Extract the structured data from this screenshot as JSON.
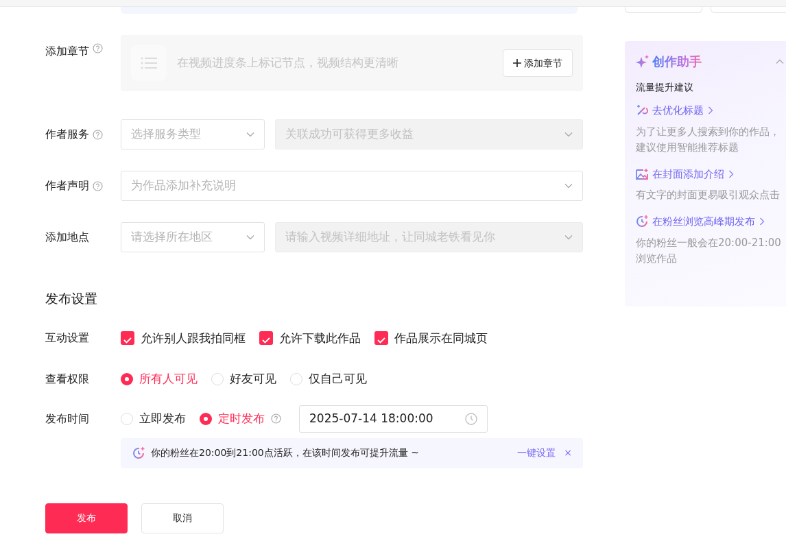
{
  "chapter": {
    "label": "添加章节",
    "hint": "在视频进度条上标记节点，视频结构更清晰",
    "button": "添加章节"
  },
  "select_rows": [
    {
      "label": "作者服务",
      "help": true,
      "selects": [
        {
          "placeholder": "选择服务类型",
          "disabled": false,
          "wide": false
        },
        {
          "placeholder": "关联成功可获得更多收益",
          "disabled": true,
          "wide": true
        }
      ]
    },
    {
      "label": "作者声明",
      "help": true,
      "selects": [
        {
          "placeholder": "为作品添加补充说明",
          "disabled": false,
          "wide": true
        }
      ]
    },
    {
      "label": "添加地点",
      "help": false,
      "selects": [
        {
          "placeholder": "请选择所在地区",
          "disabled": false,
          "wide": false
        },
        {
          "placeholder": "请输入视频详细地址，让同城老铁看见你",
          "disabled": true,
          "wide": true
        }
      ]
    }
  ],
  "publish_settings": {
    "heading": "发布设置",
    "interaction": {
      "label": "互动设置",
      "options": [
        {
          "label": "允许别人跟我拍同框",
          "checked": true
        },
        {
          "label": "允许下载此作品",
          "checked": true
        },
        {
          "label": "作品展示在同城页",
          "checked": true
        }
      ]
    },
    "visibility": {
      "label": "查看权限",
      "options": [
        {
          "label": "所有人可见",
          "selected": true
        },
        {
          "label": "好友可见",
          "selected": false
        },
        {
          "label": "仅自己可见",
          "selected": false
        }
      ]
    },
    "publish_time": {
      "label": "发布时间",
      "options": [
        {
          "label": "立即发布",
          "selected": false,
          "help": false
        },
        {
          "label": "定时发布",
          "selected": true,
          "help": true
        }
      ],
      "datetime": "2025-07-14 18:00:00"
    },
    "tip": {
      "text": "你的粉丝在20:00到21:00点活跃，在该时间发布可提升流量 ~",
      "action": "一键设置",
      "close": "×"
    }
  },
  "buttons": [
    {
      "label": "发布",
      "kind": "primary"
    },
    {
      "label": "取消",
      "kind": "secondary"
    }
  ],
  "assistant": {
    "title": "创作助手",
    "expanded": true,
    "subtitle": "流量提升建议",
    "items": [
      {
        "kind": "wand",
        "title": "去优化标题",
        "desc": "为了让更多人搜索到你的作品，建议使用智能推荐标题"
      },
      {
        "kind": "image",
        "title": "在封面添加介绍",
        "desc": "有文字的封面更易吸引观众点击"
      },
      {
        "kind": "clock",
        "title": "在粉丝浏览高峰期发布",
        "desc": "你的粉丝一般会在20:00-21:00浏览作品"
      }
    ]
  }
}
